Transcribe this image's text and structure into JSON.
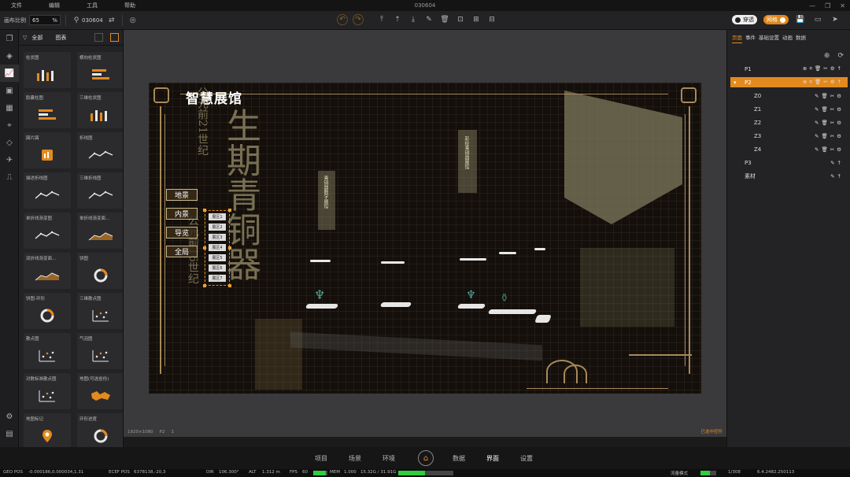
{
  "window": {
    "title": "030604"
  },
  "menu": [
    "文件",
    "编辑",
    "工具",
    "帮助"
  ],
  "toolbar": {
    "zoom_label": "画布比例",
    "zoom_value": "65",
    "zoom_unit": "%",
    "scene_name": "030604",
    "toggle_dark_label": "穿透",
    "toggle_orange_label": "网格"
  },
  "component_panel": {
    "filter_label": "全部",
    "category_label": "图表",
    "items": [
      {
        "name": "柱状图",
        "icon": "bar-chart-icon"
      },
      {
        "name": "横向柱状图",
        "icon": "horizontal-bar-icon"
      },
      {
        "name": "胶囊柱图",
        "icon": "capsule-bar-icon"
      },
      {
        "name": "三维柱状图",
        "icon": "3d-bar-icon"
      },
      {
        "name": "図片図",
        "icon": "image-chart-icon"
      },
      {
        "name": "折线图",
        "icon": "line-chart-icon"
      },
      {
        "name": "描述折线图",
        "icon": "desc-line-icon"
      },
      {
        "name": "三维折线图",
        "icon": "3d-line-icon"
      },
      {
        "name": "单折线渐变图",
        "icon": "gradient-line-icon"
      },
      {
        "name": "单折线渐变面...",
        "icon": "gradient-area-icon"
      },
      {
        "name": "双折线渐变面...",
        "icon": "double-area-icon"
      },
      {
        "name": "饼图",
        "icon": "pie-chart-icon"
      },
      {
        "name": "饼图-环形",
        "icon": "ring-chart-icon"
      },
      {
        "name": "三维散点图",
        "icon": "3d-scatter-icon"
      },
      {
        "name": "散点图",
        "icon": "scatter-icon"
      },
      {
        "name": "气泡图",
        "icon": "bubble-icon"
      },
      {
        "name": "对数标准散点图",
        "icon": "log-scatter-icon"
      },
      {
        "name": "地图(可选省份)",
        "icon": "map-icon"
      },
      {
        "name": "地图标记",
        "icon": "map-marker-icon"
      },
      {
        "name": "环形进度",
        "icon": "ring-progress-icon"
      }
    ]
  },
  "artboard": {
    "title": "智慧展馆",
    "big_text_1": "生期青铜器",
    "small_text": "公元前21世纪",
    "small_text_2": "公元前16世纪",
    "nav_buttons": [
      "地景",
      "内景",
      "导览",
      "全局"
    ],
    "sub_buttons": [
      "展区1",
      "展区2",
      "展区3",
      "展区4",
      "展区5",
      "展区6",
      "展区7"
    ],
    "banner_1": "青铜器数字展馆",
    "banner_2": "彩绘青铜器展馆"
  },
  "canvas_status": {
    "resolution": "1920×1080",
    "page": "P2",
    "layer": "1",
    "right": "已选中控件"
  },
  "right_panel": {
    "tabs": [
      "页面",
      "事件",
      "基础设置",
      "动画",
      "数据"
    ],
    "tree": [
      {
        "label": "P1",
        "level": 0,
        "selected": false
      },
      {
        "label": "P2",
        "level": 0,
        "selected": true
      },
      {
        "label": "Z0",
        "level": 1,
        "selected": false
      },
      {
        "label": "Z1",
        "level": 1,
        "selected": false
      },
      {
        "label": "Z2",
        "level": 1,
        "selected": false
      },
      {
        "label": "Z3",
        "level": 1,
        "selected": false
      },
      {
        "label": "Z4",
        "level": 1,
        "selected": false
      },
      {
        "label": "P3",
        "level": 0,
        "selected": false
      },
      {
        "label": "素材",
        "level": 0,
        "selected": false
      }
    ]
  },
  "bottom_nav": [
    "项目",
    "场景",
    "环境",
    "数据",
    "界面",
    "设置"
  ],
  "bottom_nav_active": "界面",
  "status": {
    "geo_pos_label": "GEO POS",
    "geo_pos": "-0.000186,0.000034,1.31",
    "ecef_label": "ECEF POS",
    "ecef": "6378138,-20,3",
    "dir_label": "DIR",
    "dir": "106.300°",
    "alt_label": "ALT",
    "alt": "1.312 m",
    "fps_label": "FPS",
    "fps": "60",
    "fps_fill": 0.9,
    "mem_label": "MEM",
    "mem": "1.000",
    "gpu": "15.32G / 31.91G",
    "gpu_fill": 0.48,
    "mode": "流量模式",
    "page_count": "1/308",
    "coords": "6.4.2482.250113"
  },
  "colors": {
    "accent": "#e38a1e",
    "bg": "#1b1b1c",
    "panel": "#232325"
  }
}
